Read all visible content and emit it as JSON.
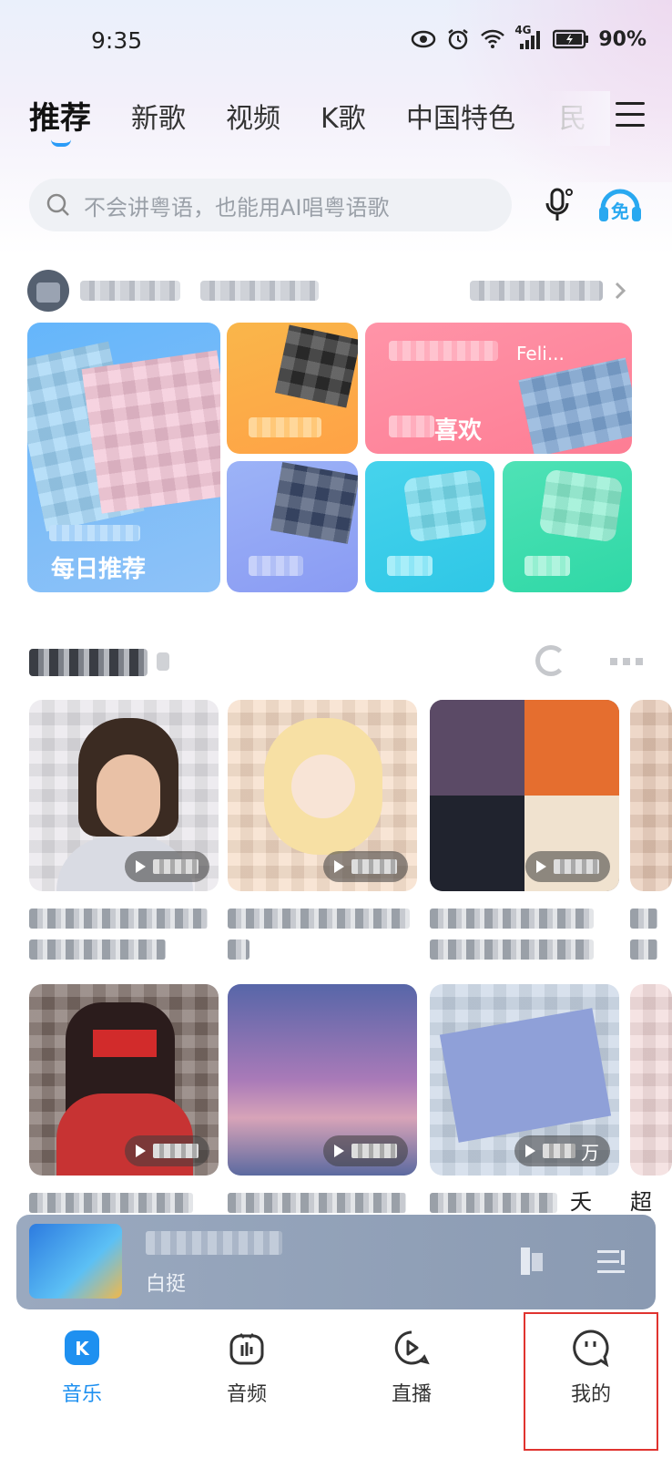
{
  "status_bar": {
    "time": "9:35",
    "network": "4G",
    "battery": "90%"
  },
  "tabs": [
    {
      "label": "推荐",
      "active": true
    },
    {
      "label": "新歌"
    },
    {
      "label": "视频"
    },
    {
      "label": "K歌"
    },
    {
      "label": "中国特色"
    },
    {
      "label": "民"
    }
  ],
  "search": {
    "placeholder": "不会讲粤语，也能用AI唱粤语歌"
  },
  "feature_cards": {
    "daily": "每日推荐",
    "guess": "喜欢",
    "guess_sub": "Feli..."
  },
  "playlists_row2": {
    "item3_title_tail": "夭",
    "item4_title": "超给",
    "item3_count_unit": "万"
  },
  "player": {
    "artist": "白挺"
  },
  "bottom_nav": [
    {
      "label": "音乐",
      "icon": "music-k-icon",
      "active": true
    },
    {
      "label": "音频",
      "icon": "audio-icon"
    },
    {
      "label": "直播",
      "icon": "live-icon"
    },
    {
      "label": "我的",
      "icon": "me-icon"
    }
  ],
  "colors": {
    "accent": "#1e90f0",
    "highlight_box": "#e0332f"
  }
}
